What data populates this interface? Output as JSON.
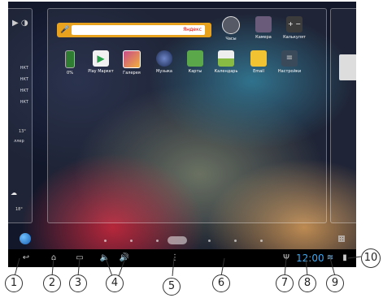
{
  "search": {
    "brand": "Яндекс"
  },
  "apps_row1": [
    {
      "label": "Часы",
      "icon": "clock-icon",
      "color": "#555a66"
    },
    {
      "label": "Камера",
      "icon": "camera-icon",
      "color": "#6a5b7a"
    },
    {
      "label": "Калькулят",
      "icon": "calculator-icon",
      "color": "#3b3b3b"
    }
  ],
  "apps_row2": [
    {
      "label": "0%",
      "icon": "battery-widget-icon",
      "color": "#2e7d32"
    },
    {
      "label": "Play Маркет",
      "icon": "play-store-icon",
      "color": "#f1f1f1"
    },
    {
      "label": "Галерея",
      "icon": "gallery-icon",
      "color": "#c84a8a"
    },
    {
      "label": "Музыка",
      "icon": "music-icon",
      "color": "#2b3d6b"
    },
    {
      "label": "Карты",
      "icon": "maps-icon",
      "color": "#5aa84a"
    },
    {
      "label": "Календарь",
      "icon": "calendar-icon",
      "color": "#88bb44"
    },
    {
      "label": "Email",
      "icon": "email-icon",
      "color": "#f1c232"
    },
    {
      "label": "Настройки",
      "icon": "settings-icon",
      "color": "#3a4a5a"
    }
  ],
  "left_panel": {
    "items": [
      "НКТ",
      "НКТ",
      "НКТ",
      "НКТ"
    ],
    "temp1": "13°",
    "label": "ллер",
    "temp2": "18°"
  },
  "status": {
    "time": "12:00"
  },
  "callouts": [
    "1",
    "2",
    "3",
    "4",
    "5",
    "6",
    "7",
    "8",
    "9",
    "10"
  ]
}
